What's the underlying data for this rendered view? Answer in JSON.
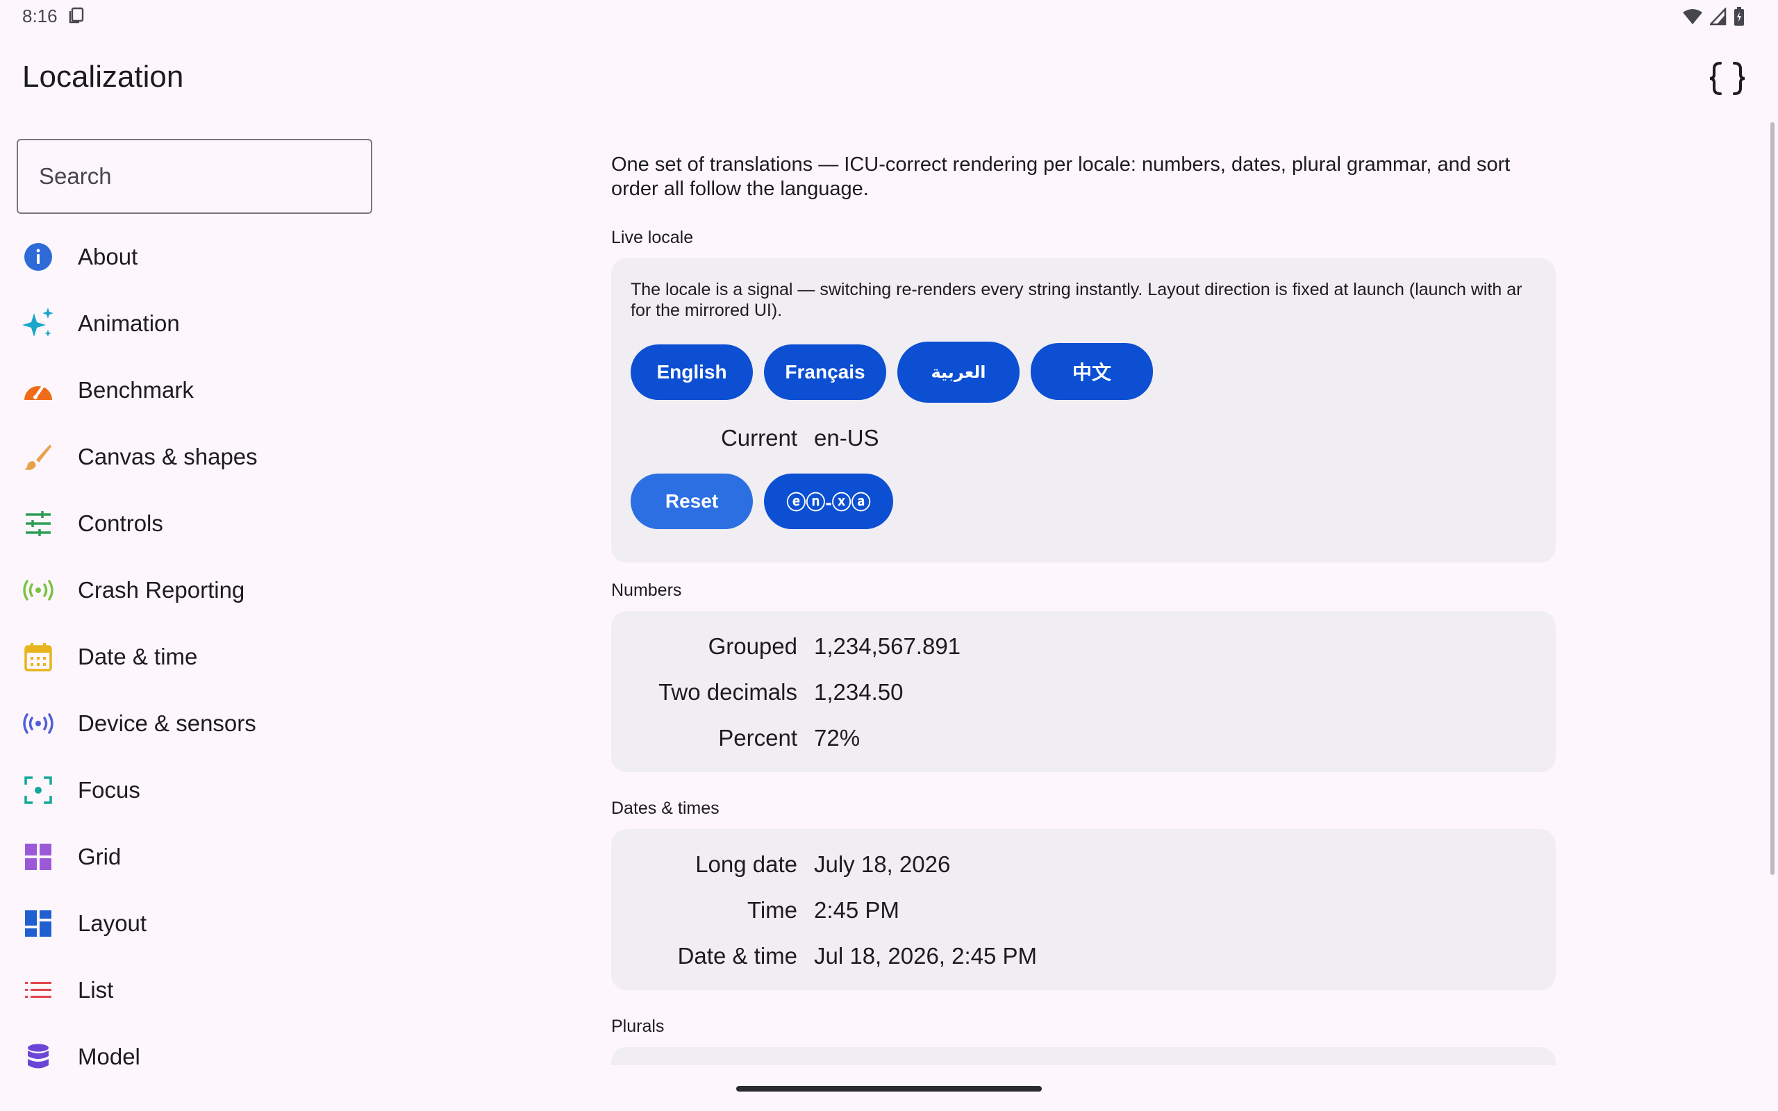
{
  "status": {
    "time": "8:16"
  },
  "app": {
    "title": "Localization"
  },
  "search": {
    "placeholder": "Search"
  },
  "sidebar": {
    "items": [
      {
        "label": "About",
        "icon": "info-icon",
        "color": "#2e6ad8"
      },
      {
        "label": "Animation",
        "icon": "sparkle-icon",
        "color": "#1aa6c9"
      },
      {
        "label": "Benchmark",
        "icon": "speedometer-icon",
        "color": "#ef6c1a"
      },
      {
        "label": "Canvas & shapes",
        "icon": "brush-icon",
        "color": "#e8a24a"
      },
      {
        "label": "Controls",
        "icon": "sliders-icon",
        "color": "#2e9d57"
      },
      {
        "label": "Crash Reporting",
        "icon": "broadcast-icon",
        "color": "#7cc242"
      },
      {
        "label": "Date & time",
        "icon": "calendar-icon",
        "color": "#e6b41d"
      },
      {
        "label": "Device & sensors",
        "icon": "sensors-icon",
        "color": "#4f5fd6"
      },
      {
        "label": "Focus",
        "icon": "focus-icon",
        "color": "#14a89a"
      },
      {
        "label": "Grid",
        "icon": "grid-icon",
        "color": "#9b59d8"
      },
      {
        "label": "Layout",
        "icon": "dashboard-icon",
        "color": "#1f5fcf"
      },
      {
        "label": "List",
        "icon": "list-icon",
        "color": "#e0454a"
      },
      {
        "label": "Model",
        "icon": "database-icon",
        "color": "#6b46d6"
      }
    ]
  },
  "content": {
    "intro": "One set of translations — ICU-correct rendering per locale: numbers, dates, plural grammar, and sort order all follow the language.",
    "live_locale": {
      "label": "Live locale",
      "description": "The locale is a signal — switching re-renders every string instantly. Layout direction is fixed at launch (launch with ar for the mirrored UI).",
      "buttons": [
        "English",
        "Français",
        "العربية",
        "中文"
      ],
      "current_label": "Current",
      "current_value": "en-US",
      "reset_label": "Reset",
      "pseudo_label": "ⓔⓝ-ⓧⓐ"
    },
    "numbers": {
      "label": "Numbers",
      "rows": [
        {
          "label": "Grouped",
          "value": "1,234,567.891"
        },
        {
          "label": "Two decimals",
          "value": "1,234.50"
        },
        {
          "label": "Percent",
          "value": "72%"
        }
      ]
    },
    "dates": {
      "label": "Dates & times",
      "rows": [
        {
          "label": "Long date",
          "value": "July 18, 2026"
        },
        {
          "label": "Time",
          "value": "2:45 PM"
        },
        {
          "label": "Date & time",
          "value": "Jul 18, 2026, 2:45 PM"
        }
      ]
    },
    "plurals": {
      "label": "Plurals"
    }
  },
  "colors": {
    "primary_button": "#0c4fd2",
    "tonal_button": "#2b6fe3",
    "card_bg": "#f0edf3",
    "background": "#fdf7fd"
  }
}
